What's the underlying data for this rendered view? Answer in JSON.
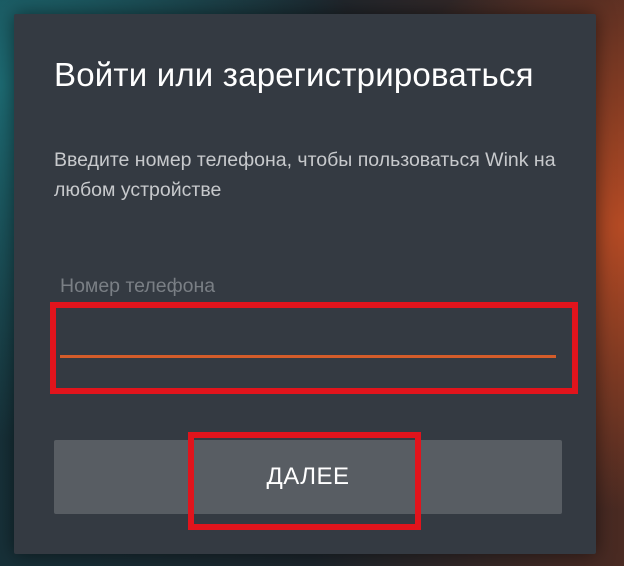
{
  "dialog": {
    "title": "Войти или зарегистрироваться",
    "subtitle": "Введите номер телефона, чтобы пользоваться Wink на любом устройстве"
  },
  "phone_field": {
    "label": "Номер телефона",
    "value": "",
    "placeholder": ""
  },
  "next_button": {
    "label": "ДАЛЕЕ"
  },
  "colors": {
    "dialog_background": "#343a42",
    "input_underline_accent": "#d35c2a",
    "button_background": "#585d63",
    "annotation_highlight": "#e1141c"
  }
}
